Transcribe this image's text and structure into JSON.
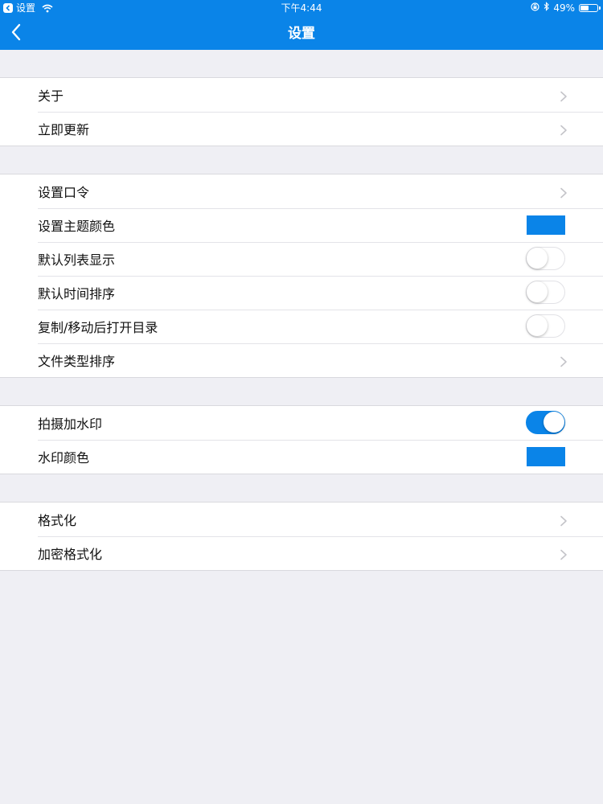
{
  "status_bar": {
    "back_app": "设置",
    "time": "下午4:44",
    "battery": "49%",
    "battery_level": 0.49
  },
  "nav": {
    "title": "设置"
  },
  "colors": {
    "accent": "#0a84e8",
    "theme_swatch": "#0a84e8",
    "watermark_swatch": "#0a84e8"
  },
  "groups": [
    {
      "rows": [
        {
          "label": "关于",
          "control": "chevron"
        },
        {
          "label": "立即更新",
          "control": "chevron"
        }
      ]
    },
    {
      "rows": [
        {
          "label": "设置口令",
          "control": "chevron"
        },
        {
          "label": "设置主题颜色",
          "control": "swatch"
        },
        {
          "label": "默认列表显示",
          "control": "toggle",
          "on": false
        },
        {
          "label": "默认时间排序",
          "control": "toggle",
          "on": false
        },
        {
          "label": "复制/移动后打开目录",
          "control": "toggle",
          "on": false
        },
        {
          "label": "文件类型排序",
          "control": "chevron"
        }
      ]
    },
    {
      "rows": [
        {
          "label": "拍摄加水印",
          "control": "toggle",
          "on": true
        },
        {
          "label": "水印颜色",
          "control": "swatch"
        }
      ]
    },
    {
      "rows": [
        {
          "label": "格式化",
          "control": "chevron"
        },
        {
          "label": "加密格式化",
          "control": "chevron"
        }
      ]
    }
  ]
}
